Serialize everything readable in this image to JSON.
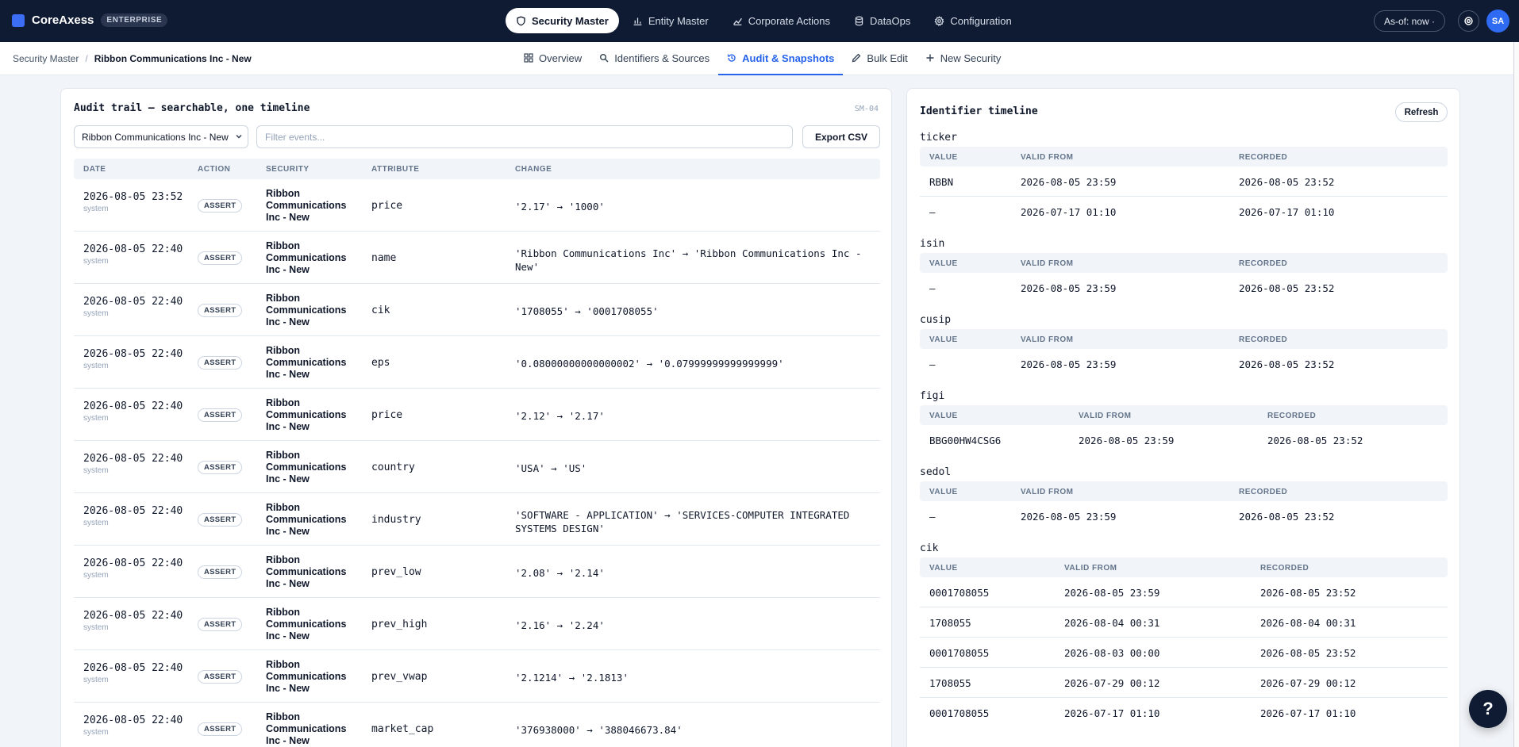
{
  "brand": {
    "name": "CoreAxess",
    "edition": "ENTERPRISE"
  },
  "nav": [
    {
      "label": "Security Master",
      "icon": "shield-icon",
      "active": true
    },
    {
      "label": "Entity Master",
      "icon": "bar-chart-icon",
      "active": false
    },
    {
      "label": "Corporate Actions",
      "icon": "trend-icon",
      "active": false
    },
    {
      "label": "DataOps",
      "icon": "database-icon",
      "active": false
    },
    {
      "label": "Configuration",
      "icon": "gear-icon",
      "active": false
    }
  ],
  "header": {
    "asof": "As-of: now ·",
    "avatar": "SA"
  },
  "breadcrumb": {
    "root": "Security Master",
    "sep": "/",
    "current": "Ribbon Communications Inc - New"
  },
  "subtabs": [
    {
      "label": "Overview",
      "icon": "grid-icon",
      "active": false
    },
    {
      "label": "Identifiers & Sources",
      "icon": "search-icon",
      "active": false
    },
    {
      "label": "Audit & Snapshots",
      "icon": "history-icon",
      "active": true
    },
    {
      "label": "Bulk Edit",
      "icon": "pencil-icon",
      "active": false
    },
    {
      "label": "New Security",
      "icon": "plus-icon",
      "active": false
    }
  ],
  "audit": {
    "title": "Audit trail — searchable, one timeline",
    "code": "SM-04",
    "select_value": "Ribbon Communications Inc - New",
    "filter_placeholder": "Filter events...",
    "export_label": "Export CSV",
    "columns": [
      "DATE",
      "ACTION",
      "SECURITY",
      "ATTRIBUTE",
      "CHANGE"
    ],
    "rows": [
      {
        "date": "2026-08-05 23:52",
        "user": "system",
        "action": "ASSERT",
        "security": "Ribbon Communications Inc - New",
        "attribute": "price",
        "change": "'2.17' → '1000'"
      },
      {
        "date": "2026-08-05 22:40",
        "user": "system",
        "action": "ASSERT",
        "security": "Ribbon Communications Inc - New",
        "attribute": "name",
        "change": "'Ribbon Communications Inc' → 'Ribbon Communications Inc - New'"
      },
      {
        "date": "2026-08-05 22:40",
        "user": "system",
        "action": "ASSERT",
        "security": "Ribbon Communications Inc - New",
        "attribute": "cik",
        "change": "'1708055' → '0001708055'"
      },
      {
        "date": "2026-08-05 22:40",
        "user": "system",
        "action": "ASSERT",
        "security": "Ribbon Communications Inc - New",
        "attribute": "eps",
        "change": "'0.08000000000000002' → '0.07999999999999999'"
      },
      {
        "date": "2026-08-05 22:40",
        "user": "system",
        "action": "ASSERT",
        "security": "Ribbon Communications Inc - New",
        "attribute": "price",
        "change": "'2.12' → '2.17'"
      },
      {
        "date": "2026-08-05 22:40",
        "user": "system",
        "action": "ASSERT",
        "security": "Ribbon Communications Inc - New",
        "attribute": "country",
        "change": "'USA' → 'US'"
      },
      {
        "date": "2026-08-05 22:40",
        "user": "system",
        "action": "ASSERT",
        "security": "Ribbon Communications Inc - New",
        "attribute": "industry",
        "change": "'SOFTWARE - APPLICATION' → 'SERVICES-COMPUTER INTEGRATED SYSTEMS DESIGN'"
      },
      {
        "date": "2026-08-05 22:40",
        "user": "system",
        "action": "ASSERT",
        "security": "Ribbon Communications Inc - New",
        "attribute": "prev_low",
        "change": "'2.08' → '2.14'"
      },
      {
        "date": "2026-08-05 22:40",
        "user": "system",
        "action": "ASSERT",
        "security": "Ribbon Communications Inc - New",
        "attribute": "prev_high",
        "change": "'2.16' → '2.24'"
      },
      {
        "date": "2026-08-05 22:40",
        "user": "system",
        "action": "ASSERT",
        "security": "Ribbon Communications Inc - New",
        "attribute": "prev_vwap",
        "change": "'2.1214' → '2.1813'"
      },
      {
        "date": "2026-08-05 22:40",
        "user": "system",
        "action": "ASSERT",
        "security": "Ribbon Communications Inc - New",
        "attribute": "market_cap",
        "change": "'376938000' → '388046673.84'"
      }
    ]
  },
  "identifiers": {
    "title": "Identifier timeline",
    "refresh_label": "Refresh",
    "columns": [
      "VALUE",
      "VALID FROM",
      "RECORDED"
    ],
    "sections": [
      {
        "name": "ticker",
        "rows": [
          {
            "value": "RBBN",
            "valid_from": "2026-08-05 23:59",
            "recorded": "2026-08-05 23:52"
          },
          {
            "value": "—",
            "valid_from": "2026-07-17 01:10",
            "recorded": "2026-07-17 01:10"
          }
        ]
      },
      {
        "name": "isin",
        "rows": [
          {
            "value": "—",
            "valid_from": "2026-08-05 23:59",
            "recorded": "2026-08-05 23:52"
          }
        ]
      },
      {
        "name": "cusip",
        "rows": [
          {
            "value": "—",
            "valid_from": "2026-08-05 23:59",
            "recorded": "2026-08-05 23:52"
          }
        ]
      },
      {
        "name": "figi",
        "rows": [
          {
            "value": "BBG00HW4CSG6",
            "valid_from": "2026-08-05 23:59",
            "recorded": "2026-08-05 23:52"
          }
        ]
      },
      {
        "name": "sedol",
        "rows": [
          {
            "value": "—",
            "valid_from": "2026-08-05 23:59",
            "recorded": "2026-08-05 23:52"
          }
        ]
      },
      {
        "name": "cik",
        "rows": [
          {
            "value": "0001708055",
            "valid_from": "2026-08-05 23:59",
            "recorded": "2026-08-05 23:52"
          },
          {
            "value": "1708055",
            "valid_from": "2026-08-04 00:31",
            "recorded": "2026-08-04 00:31"
          },
          {
            "value": "0001708055",
            "valid_from": "2026-08-03 00:00",
            "recorded": "2026-08-05 23:52"
          },
          {
            "value": "1708055",
            "valid_from": "2026-07-29 00:12",
            "recorded": "2026-07-29 00:12"
          },
          {
            "value": "0001708055",
            "valid_from": "2026-07-17 01:10",
            "recorded": "2026-07-17 01:10"
          }
        ]
      }
    ]
  },
  "help": {
    "label": "?"
  }
}
